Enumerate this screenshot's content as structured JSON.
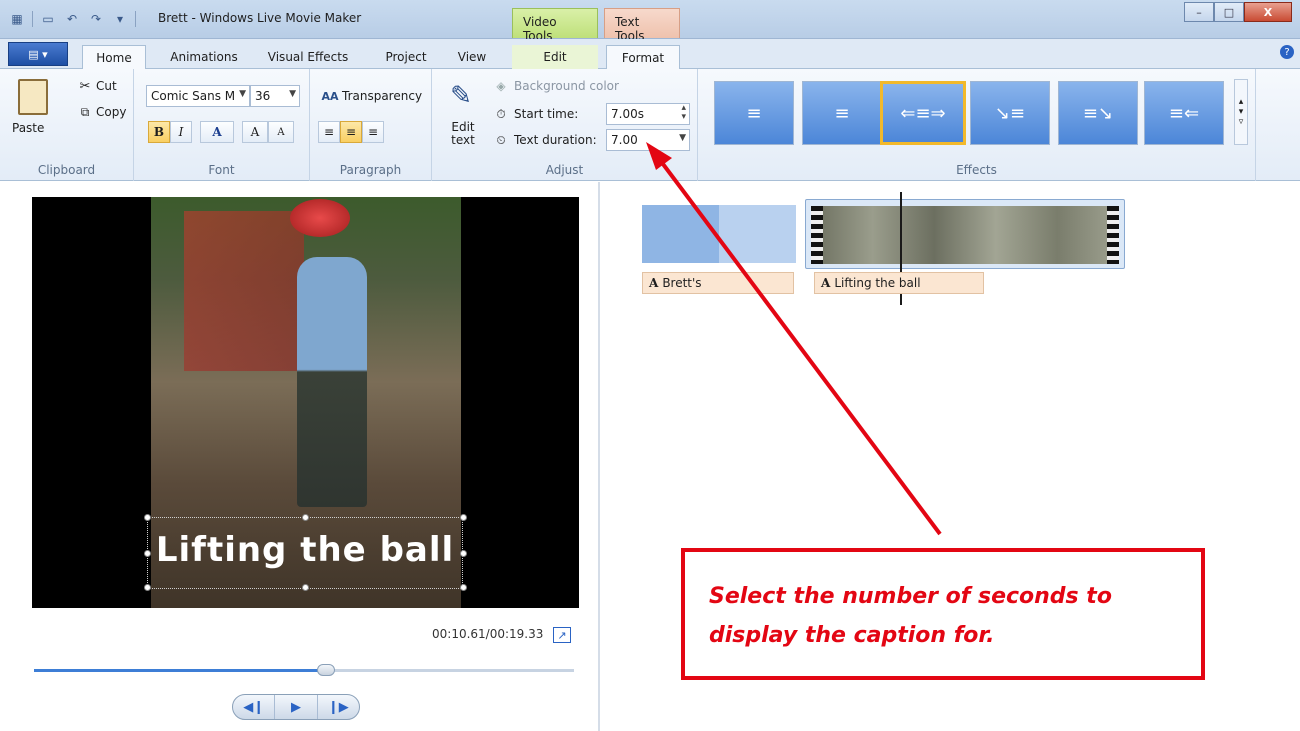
{
  "window": {
    "title": "Brett - Windows Live Movie Maker",
    "context_tabs": [
      "Video Tools",
      "Text Tools"
    ],
    "controls": {
      "minimize": "–",
      "maximize": "□",
      "close": "X"
    }
  },
  "ribbon_tabs": [
    "Home",
    "Animations",
    "Visual Effects",
    "Project",
    "View",
    "Edit",
    "Format"
  ],
  "active_tab": "Format",
  "ribbon": {
    "clipboard": {
      "paste": "Paste",
      "cut": "Cut",
      "copy": "Copy",
      "label": "Clipboard"
    },
    "font": {
      "family": "Comic Sans M",
      "size": "36",
      "bold": "B",
      "italic": "I",
      "color": "A",
      "grow": "A",
      "shrink": "A",
      "label": "Font"
    },
    "paragraph": {
      "transparency": "Transparency",
      "label": "Paragraph"
    },
    "adjust": {
      "edit_text": "Edit text",
      "background_color": "Background color",
      "start_time_label": "Start time:",
      "start_time_value": "7.00s",
      "text_duration_label": "Text duration:",
      "text_duration_value": "7.00",
      "label": "Adjust"
    },
    "effects": {
      "label": "Effects",
      "selected_index": 2,
      "count": 6
    }
  },
  "preview": {
    "caption": "Lifting the ball",
    "timecode": "00:10.61/00:19.33",
    "seek_progress": 0.54
  },
  "storyboard": {
    "captions": [
      "Brett's",
      "Lifting the ball"
    ]
  },
  "annotation": {
    "text": "Select the number of seconds to display the caption for."
  },
  "colors": {
    "annotation_red": "#e30613",
    "selected_effect_border": "#f2b92b",
    "accent_blue": "#2a63c4"
  }
}
